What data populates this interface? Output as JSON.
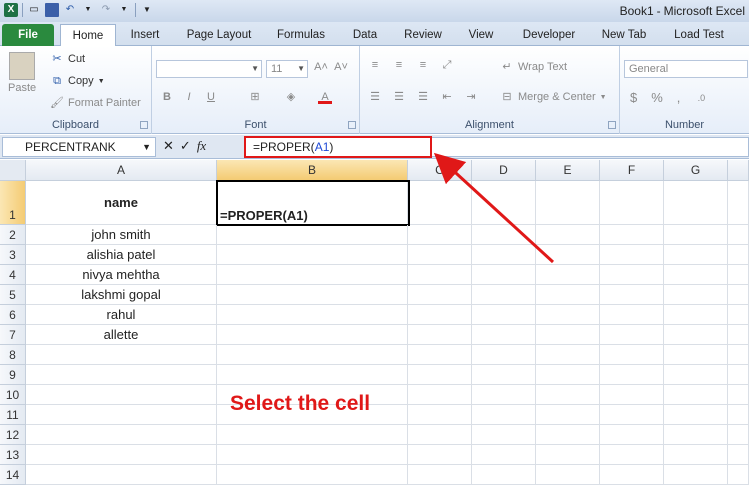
{
  "window": {
    "doc_name": "Book1",
    "app_name": "Microsoft Excel"
  },
  "tabs": [
    "File",
    "Home",
    "Insert",
    "Page Layout",
    "Formulas",
    "Data",
    "Review",
    "View",
    "Developer",
    "New Tab",
    "Load Test"
  ],
  "ribbon": {
    "clipboard": {
      "paste": "Paste",
      "cut": "Cut",
      "copy": "Copy",
      "format_painter": "Format Painter",
      "label": "Clipboard"
    },
    "font": {
      "size": "11",
      "bold": "B",
      "italic": "I",
      "underline": "U",
      "label": "Font"
    },
    "alignment": {
      "wrap": "Wrap Text",
      "merge": "Merge & Center",
      "label": "Alignment"
    },
    "number": {
      "format": "General",
      "currency": "$",
      "percent": "%",
      "comma": ",",
      "label": "Number"
    }
  },
  "formula_bar": {
    "name_box": "PERCENTRANK",
    "formula_prefix": "=PROPER(",
    "formula_ref": "A1",
    "formula_suffix": ")",
    "fx": "fx"
  },
  "columns": [
    "A",
    "B",
    "C",
    "D",
    "E",
    "F",
    "G"
  ],
  "rows": [
    "1",
    "2",
    "3",
    "4",
    "5",
    "6",
    "7",
    "8",
    "9",
    "10",
    "11",
    "12",
    "13",
    "14"
  ],
  "cells": {
    "a1": "name",
    "b1": "=PROPER(A1)",
    "names": [
      "john smith",
      "alishia patel",
      "nivya mehtha",
      "lakshmi gopal",
      "rahul",
      "allette"
    ]
  },
  "annotation": {
    "text": "Select the cell",
    "color": "#e01818"
  }
}
